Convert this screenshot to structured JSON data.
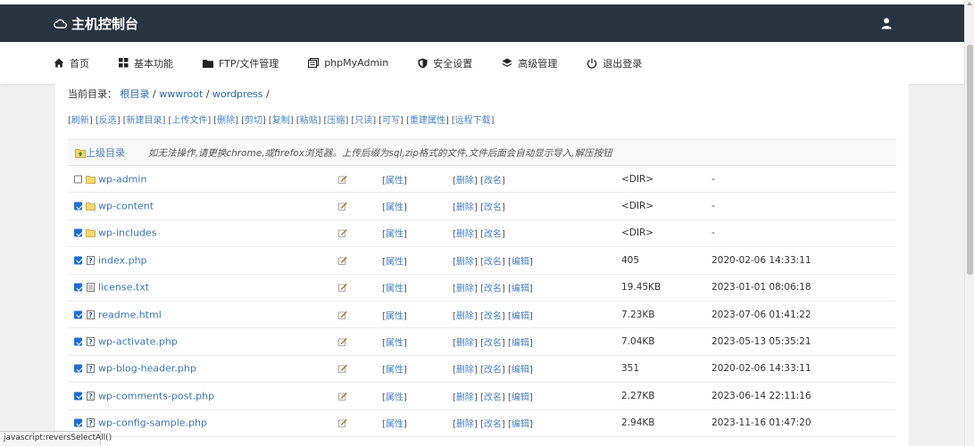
{
  "header": {
    "title": "主机控制台"
  },
  "nav": [
    {
      "label": "首页",
      "icon": "home-icon"
    },
    {
      "label": "基本功能",
      "icon": "grid-icon"
    },
    {
      "label": "FTP/文件管理",
      "icon": "folder-icon"
    },
    {
      "label": "phpMyAdmin",
      "icon": "database-icon"
    },
    {
      "label": "安全设置",
      "icon": "shield-icon"
    },
    {
      "label": "高级管理",
      "icon": "layers-icon"
    },
    {
      "label": "退出登录",
      "icon": "power-icon"
    }
  ],
  "breadcrumb": {
    "prefix": "当前目录：",
    "root": "根目录",
    "level1": "wwwroot",
    "level2": "wordpress",
    "sep": "/"
  },
  "toolbar": [
    "刷新",
    "反选",
    "新建目录",
    "上传文件",
    "删除",
    "剪切",
    "复制",
    "粘贴",
    "压缩",
    "只读",
    "可写",
    "重建属性",
    "远程下载"
  ],
  "table": {
    "parent_label": "上级目录",
    "notice": "如无法操作,请更换chrome,或firefox浏览器。上传后缀为sql,zip格式的文件,文件后面会自动显示导入,解压按钮",
    "attr_label": "属性",
    "delete_label": "删除",
    "rename_label": "改名",
    "edit_label": "编辑",
    "rows": [
      {
        "name": "wp-admin",
        "type": "dir",
        "checked": false,
        "size": "<DIR>",
        "date": "-"
      },
      {
        "name": "wp-content",
        "type": "dir",
        "checked": true,
        "size": "<DIR>",
        "date": "-"
      },
      {
        "name": "wp-includes",
        "type": "dir",
        "checked": true,
        "size": "<DIR>",
        "date": "-"
      },
      {
        "name": "index.php",
        "type": "php",
        "checked": true,
        "size": "405",
        "date": "2020-02-06 14:33:11"
      },
      {
        "name": "license.txt",
        "type": "txt",
        "checked": true,
        "size": "19.45KB",
        "date": "2023-01-01 08:06:18"
      },
      {
        "name": "readme.html",
        "type": "php",
        "checked": true,
        "size": "7.23KB",
        "date": "2023-07-06 01:41:22"
      },
      {
        "name": "wp-activate.php",
        "type": "php",
        "checked": true,
        "size": "7.04KB",
        "date": "2023-05-13 05:35:21"
      },
      {
        "name": "wp-blog-header.php",
        "type": "php",
        "checked": true,
        "size": "351",
        "date": "2020-02-06 14:33:11"
      },
      {
        "name": "wp-comments-post.php",
        "type": "php",
        "checked": true,
        "size": "2.27KB",
        "date": "2023-06-14 22:11:16"
      },
      {
        "name": "wp-config-sample.php",
        "type": "php",
        "checked": true,
        "size": "2.94KB",
        "date": "2023-11-16 01:47:20"
      }
    ]
  },
  "statusbar": "javascript:reversSelectAll()",
  "colors": {
    "header_bg": "#2a3440",
    "link": "#4a7fc0",
    "checkbox": "#1f6ed4"
  }
}
